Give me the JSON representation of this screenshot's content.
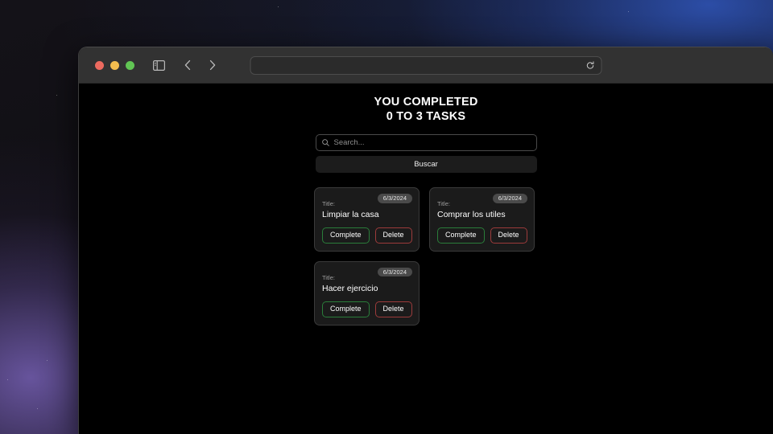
{
  "desktop": {
    "wallpaper_glow_purple": "#7660b4",
    "wallpaper_glow_blue": "#2e52b2",
    "background": "#0d0c0e"
  },
  "browser": {
    "traffic_lights": [
      {
        "name": "close",
        "color": "#ec6a5f"
      },
      {
        "name": "minimize",
        "color": "#f4bd4f"
      },
      {
        "name": "maximize",
        "color": "#61c554"
      }
    ],
    "sidebar_toggle_icon": "sidebar-icon",
    "back_icon": "chevron-left-icon",
    "forward_icon": "chevron-right-icon",
    "address_bar": {
      "value": "",
      "placeholder": "",
      "reload_icon": "reload-icon"
    }
  },
  "page": {
    "heading_line1": "YOU COMPLETED",
    "heading_line2": "0 TO 3 TASKS",
    "search": {
      "icon": "search-icon",
      "value": "",
      "placeholder": "Search...",
      "submit_label": "Buscar"
    },
    "task_label": "Title:",
    "complete_label": "Complete",
    "delete_label": "Delete",
    "accent_complete": "#2a7d3a",
    "accent_delete": "#9c3b3b",
    "tasks": [
      {
        "title": "Limpiar la casa",
        "date": "6/3/2024"
      },
      {
        "title": "Comprar los utiles",
        "date": "6/3/2024"
      },
      {
        "title": "Hacer ejercicio",
        "date": "6/3/2024"
      }
    ]
  }
}
